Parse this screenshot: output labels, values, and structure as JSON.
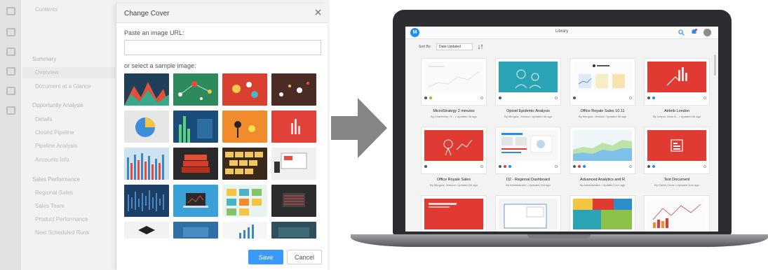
{
  "editor": {
    "toc_header": "Contents",
    "toc_items": [
      "Summary",
      "Overview",
      "Document at a Glance",
      "Opportunity Analysis",
      "Details",
      "Closed Pipeline",
      "Pipeline Analysis",
      "Accounts Info",
      "Sales Performance",
      "Regional Sales",
      "Sales Team",
      "Product Performance",
      "Next Scheduled Runs"
    ]
  },
  "dialog": {
    "title": "Change Cover",
    "url_label": "Paste an image URL:",
    "url_value": "",
    "sample_label": "or select a sample image:",
    "save_label": "Save",
    "cancel_label": "Cancel",
    "sample_images": [
      "mountains-chart",
      "network-graph",
      "red-dots",
      "scatter-dark",
      "pie-chart",
      "bar-blue-green",
      "pins-orange",
      "red-bars",
      "blue-red-bars",
      "stacked-red",
      "keyboard-tiles",
      "office-devices",
      "blue-lines",
      "laptop-chart",
      "color-tiles",
      "dark-grid",
      "graduation-cap",
      "blue-panel",
      "growth-bars",
      "teal-panel"
    ]
  },
  "library": {
    "title": "Library",
    "sort_label": "Sort By:",
    "sort_value": "Date Updated",
    "cards": [
      {
        "title": "MicroStrategy 2 minutes",
        "meta": "By Charleston, H... • Updated 3d ago",
        "theme": "white-chart"
      },
      {
        "title": "Opioid Epidemic Analysis",
        "meta": "By Murguia, Jessica • Updated 3d ago",
        "theme": "teal-people"
      },
      {
        "title": "Office Royale Sales 10.11",
        "meta": "By Murguia, Jessica • Updated 5d ago",
        "theme": "office-royale"
      },
      {
        "title": "Airbnb London",
        "meta": "By Leeper, Mark A... • Updated 5d ago",
        "theme": "red-hand"
      },
      {
        "title": "Office Royale Sales",
        "meta": "By Murguia, Jessica • Updated 6d ago",
        "theme": "red-tap"
      },
      {
        "title": "D2 - Regional Dashboard",
        "meta": "By Administrator • Updated 14d ago",
        "theme": "dashboard"
      },
      {
        "title": "Advanced Analytics and R",
        "meta": "By Administrator • Updated 1mo ago",
        "theme": "area-chart"
      },
      {
        "title": "Test Document",
        "meta": "By Calvin Chow • Updated 3mo ago",
        "theme": "red-doc"
      },
      {
        "title": "",
        "meta": "",
        "theme": "red-report"
      },
      {
        "title": "",
        "meta": "",
        "theme": "white-window"
      },
      {
        "title": "",
        "meta": "",
        "theme": "heatmap"
      },
      {
        "title": "",
        "meta": "",
        "theme": "timeline"
      }
    ]
  },
  "colors": {
    "brand_blue": "#1d8ff0",
    "save_blue": "#3b99fc",
    "red": "#e03a32",
    "laptop": "#2b2d31",
    "arrow": "#858585"
  }
}
